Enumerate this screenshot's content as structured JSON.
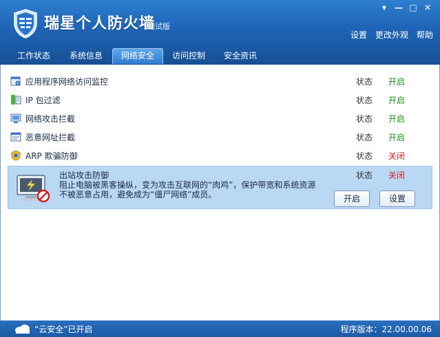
{
  "app": {
    "title": "瑞星个人防火墙",
    "subtitle": "测试版",
    "window_controls": {
      "menu": "▾",
      "minimize": "—",
      "maximize": "□",
      "close": "✕"
    },
    "top_links": [
      "设置",
      "更改外观",
      "帮助"
    ]
  },
  "tabs": [
    {
      "label": "工作状态",
      "active": false
    },
    {
      "label": "系统信息",
      "active": false
    },
    {
      "label": "网络安全",
      "active": true
    },
    {
      "label": "访问控制",
      "active": false
    },
    {
      "label": "安全资讯",
      "active": false
    }
  ],
  "features": [
    {
      "icon": "app-monitor-icon",
      "label": "应用程序网络访问监控",
      "state_label": "状态",
      "state": "开启"
    },
    {
      "icon": "ip-filter-icon",
      "label": "IP 包过滤",
      "state_label": "状态",
      "state": "开启"
    },
    {
      "icon": "attack-block-icon",
      "label": "网络攻击拦截",
      "state_label": "状态",
      "state": "开启"
    },
    {
      "icon": "malicious-url-icon",
      "label": "恶意网址拦截",
      "state_label": "状态",
      "state": "开启"
    },
    {
      "icon": "arp-defense-icon",
      "label": "ARP 欺骗防御",
      "state_label": "状态",
      "state": "关闭"
    }
  ],
  "selected_feature": {
    "icon": "outbound-attack-icon",
    "title": "出站攻击防御",
    "description": "阻止电脑被黑客操纵，变为攻击互联网的“肉鸡”，保护带宽和系统资源不被恶意占用，避免成为“僵尸网络”成员。",
    "state_label": "状态",
    "state": "关闭",
    "enable_button": "开启",
    "settings_button": "设置"
  },
  "status": {
    "cloud_text": "“云安全”已开启",
    "version_text": "程序版本：22.00.00.06"
  },
  "colors": {
    "on": "#1e8f1e",
    "off": "#d22020",
    "accent": "#1f66b8"
  }
}
